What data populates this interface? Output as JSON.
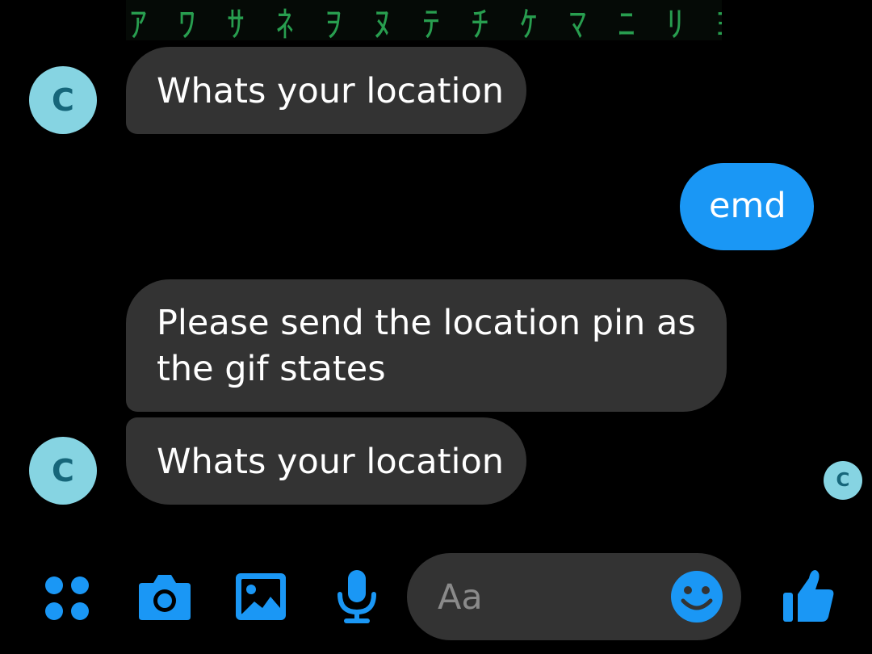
{
  "gif": {
    "glyphs": "ｱ ﾜ ｻ ﾈ ｦ ﾇ ﾃ ﾁ ｹ ﾏ ﾆ ﾘ ﾖ ｿ ﾓ"
  },
  "contact": {
    "avatar_letter": "C",
    "avatar_color": "#86d4e2"
  },
  "messages": [
    {
      "direction": "incoming",
      "text": "Whats your location"
    },
    {
      "direction": "outgoing",
      "text": "emd"
    },
    {
      "direction": "incoming",
      "text": "Please send the location pin as the gif states"
    },
    {
      "direction": "incoming",
      "text": "Whats your location"
    }
  ],
  "composer": {
    "placeholder": "Aa"
  },
  "toolbar": {
    "icons": [
      "menu-dots-icon",
      "camera-icon",
      "image-icon",
      "microphone-icon",
      "emoji-icon",
      "thumbs-up-icon"
    ],
    "accent_color": "#1a97f5"
  },
  "colors": {
    "background": "#000000",
    "incoming_bubble": "#333333",
    "outgoing_bubble": "#1a97f5"
  }
}
